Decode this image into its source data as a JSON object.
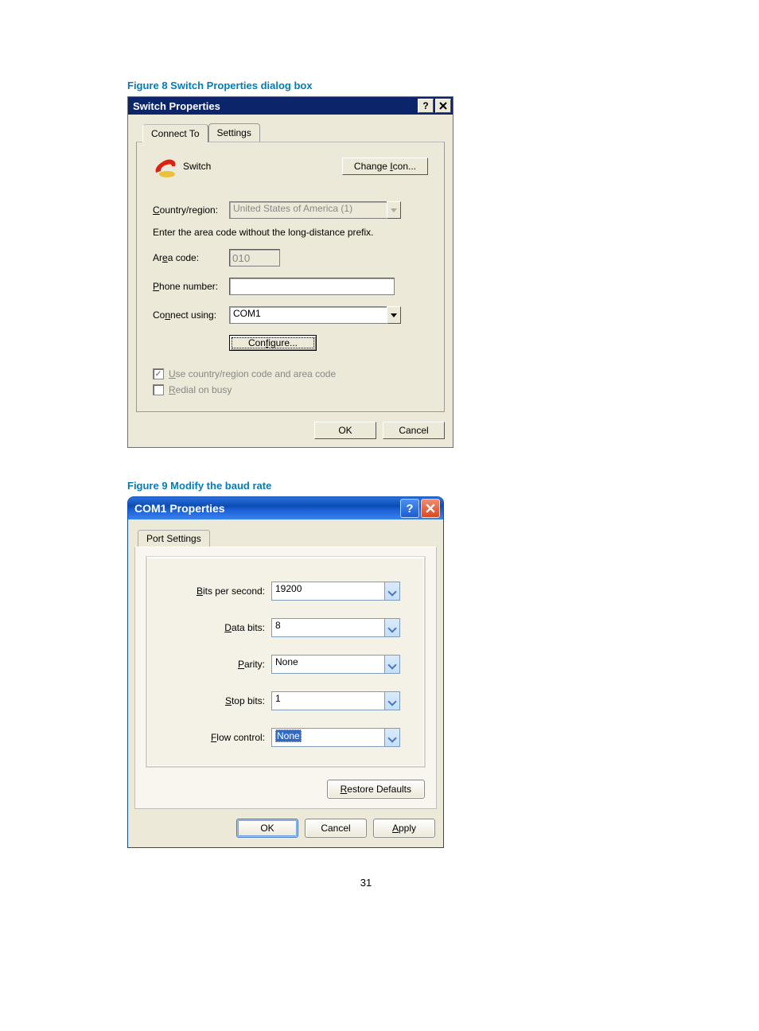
{
  "figure8": {
    "caption": "Figure 8 Switch Properties dialog box"
  },
  "figure9": {
    "caption": "Figure 9 Modify the baud rate"
  },
  "dlg1": {
    "title": "Switch Properties",
    "tabs": {
      "connect": "Connect To",
      "settings": "Settings"
    },
    "icon_label": "Switch",
    "change_icon_btn": "Change Icon...",
    "change_icon_u": "I",
    "country_label": "Country/region:",
    "country_u": "C",
    "country_value": "United States of America (1)",
    "hint": "Enter the area code without the long-distance prefix.",
    "area_label": "Area code:",
    "area_u": "e",
    "area_value": "010",
    "phone_label": "Phone number:",
    "phone_u": "P",
    "phone_value": "",
    "connect_label": "Connect using:",
    "connect_u": "n",
    "connect_value": "COM1",
    "configure_btn": "Configure...",
    "configure_u": "f",
    "chk1": "Use country/region code and area code",
    "chk1_u": "U",
    "chk2": "Redial on busy",
    "chk2_u": "R",
    "ok": "OK",
    "cancel": "Cancel"
  },
  "dlg2": {
    "title": "COM1 Properties",
    "tab": "Port Settings",
    "fields": {
      "bps_label": "Bits per second:",
      "bps_u": "B",
      "bps_value": "19200",
      "data_label": "Data bits:",
      "data_u": "D",
      "data_value": "8",
      "parity_label": "Parity:",
      "parity_u": "P",
      "parity_value": "None",
      "stop_label": "Stop bits:",
      "stop_u": "S",
      "stop_value": "1",
      "flow_label": "Flow control:",
      "flow_u": "F",
      "flow_value": "None"
    },
    "restore": "Restore Defaults",
    "restore_u": "R",
    "ok": "OK",
    "cancel": "Cancel",
    "apply": "Apply",
    "apply_u": "A"
  },
  "page_number": "31"
}
